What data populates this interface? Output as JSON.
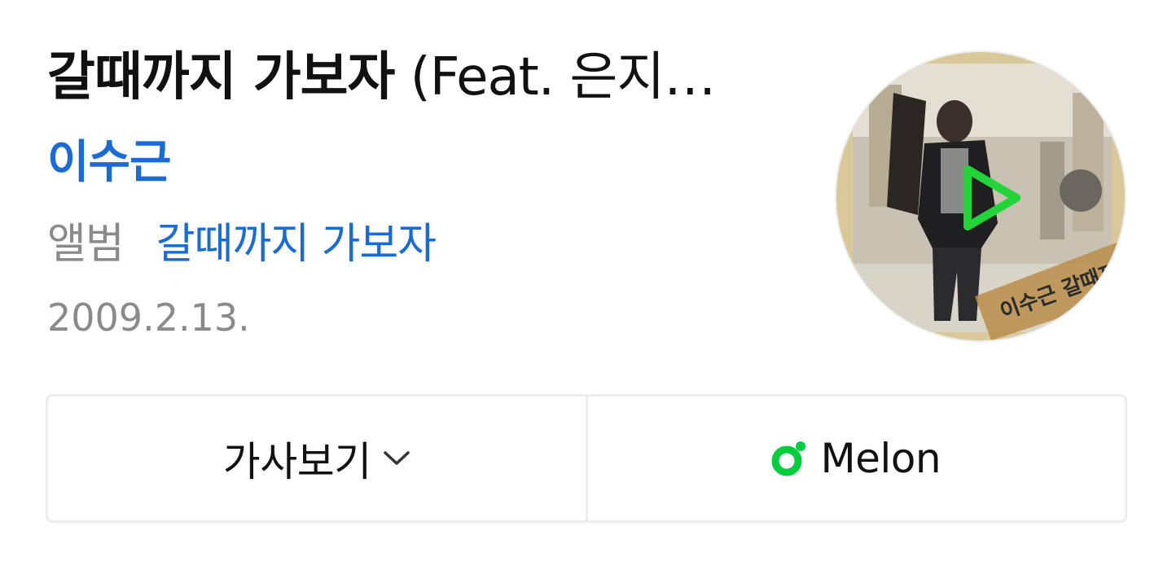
{
  "song": {
    "title": "갈때까지 가보자",
    "title_feat": " (Feat. 은지…",
    "artist": "이수근",
    "album_label": "앨범",
    "album_name": "갈때까지 가보자",
    "release_date": "2009.2.13.",
    "cover_text": "이수근 갈때까지 가보자"
  },
  "actions": {
    "lyrics_label": "가사보기",
    "melon_label": "Melon"
  },
  "icons": {
    "play": "play-icon",
    "lyrics_toggle": "chevron-down-icon",
    "melon": "melon-logo-icon"
  },
  "colors": {
    "link_blue": "#1a6bd6",
    "play_green": "#22d43a",
    "melon_green": "#00cd3c",
    "muted_gray": "#8a8a8a"
  }
}
